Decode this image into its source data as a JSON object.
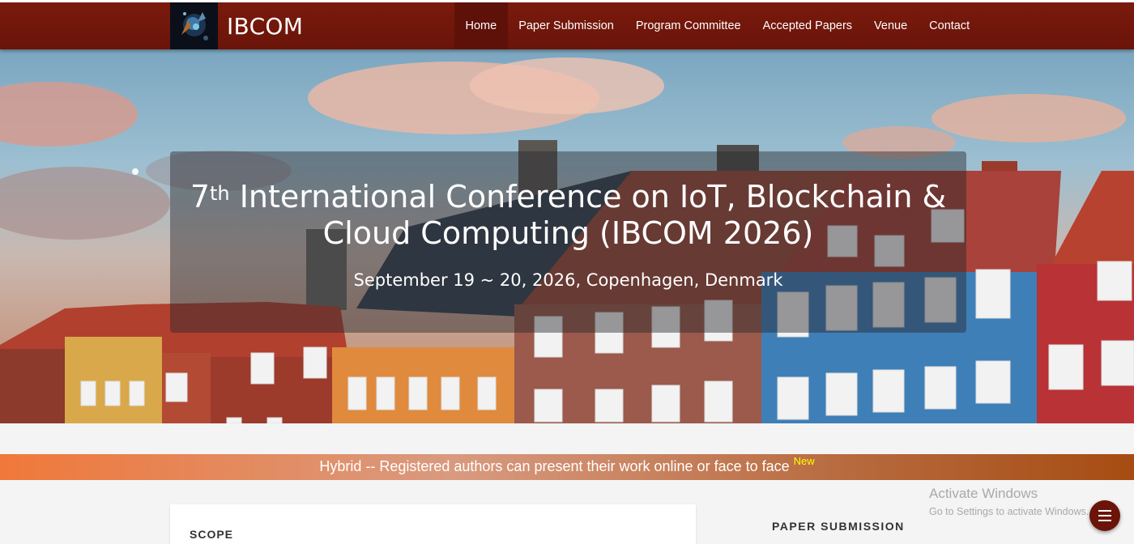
{
  "brand": {
    "name": "IBCOM"
  },
  "nav": {
    "items": [
      {
        "label": "Home",
        "active": true
      },
      {
        "label": "Paper Submission"
      },
      {
        "label": "Program Committee"
      },
      {
        "label": "Accepted Papers"
      },
      {
        "label": "Venue"
      },
      {
        "label": "Contact"
      }
    ]
  },
  "hero": {
    "ordinal_number": "7",
    "ordinal_suffix": "th",
    "title_line1_rest": " International Conference on IoT, Blockchain &",
    "title_line2": "Cloud Computing (IBCOM 2026)",
    "date_location": "September 19 ~ 20, 2026, Copenhagen, Denmark"
  },
  "banner": {
    "text": "Hybrid -- Registered authors can present their work online or face to face ",
    "badge": "New"
  },
  "content": {
    "scope_title": "SCOPE",
    "sidebar_title": "PAPER SUBMISSION"
  },
  "watermark": {
    "line1": "Activate Windows",
    "line2": "Go to Settings to activate Windows."
  },
  "colors": {
    "navbar": "#6a140a",
    "banner_start": "#f0783a",
    "banner_end": "#a64c12",
    "badge": "#ffff00"
  },
  "icons": {
    "menu_fab": "hamburger-icon"
  }
}
